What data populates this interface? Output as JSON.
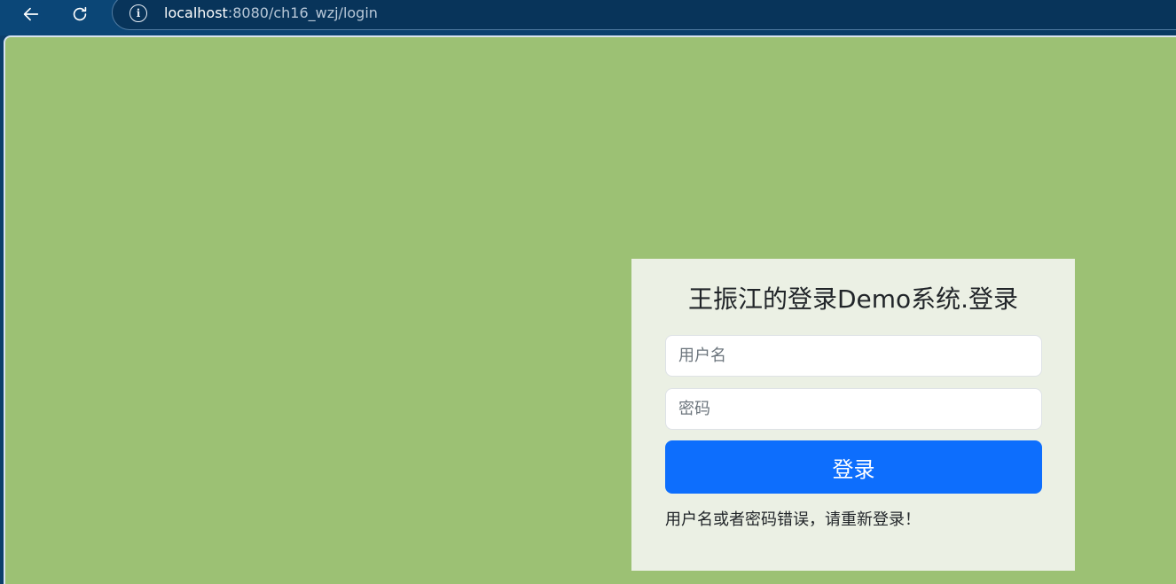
{
  "browser": {
    "url_host": "localhost",
    "url_rest": ":8080/ch16_wzj/login",
    "info_glyph": "i"
  },
  "login": {
    "title": "王振江的登录Demo系统.登录",
    "username_placeholder": "用户名",
    "password_placeholder": "密码",
    "submit_label": "登录",
    "error_message": "用户名或者密码错误，请重新登录！"
  },
  "colors": {
    "page_background": "#9cc174",
    "card_background": "#ebf0e4",
    "button_primary": "#0d6efd",
    "browser_chrome": "#0b4778"
  }
}
